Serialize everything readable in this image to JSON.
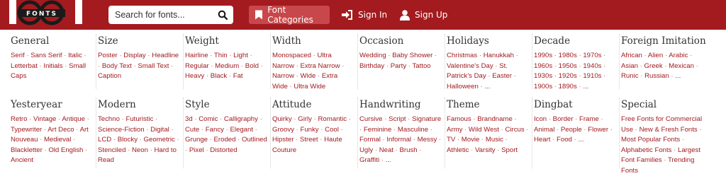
{
  "logo": {
    "text": "1001 FONTS",
    "small": "FONTS"
  },
  "search": {
    "placeholder": "Search for fonts..."
  },
  "nav": {
    "categories_label": "Font Categories",
    "signin_label": "Sign In",
    "signup_label": "Sign Up"
  },
  "categories": [
    {
      "title": "General",
      "links": [
        "Serif",
        "Sans Serif",
        "Italic",
        "Letterbat",
        "Initials",
        "Small Caps"
      ]
    },
    {
      "title": "Size",
      "links": [
        "Poster",
        "Display",
        "Headline",
        "Body Text",
        "Small Text",
        "Caption"
      ]
    },
    {
      "title": "Weight",
      "links": [
        "Hairline",
        "Thin",
        "Light",
        "Regular",
        "Medium",
        "Bold",
        "Heavy",
        "Black",
        "Fat"
      ]
    },
    {
      "title": "Width",
      "links": [
        "Monospaced",
        "Ultra Narrow",
        "Extra Narrow",
        "Narrow",
        "Wide",
        "Extra Wide",
        "Ultra Wide"
      ]
    },
    {
      "title": "Occasion",
      "links": [
        "Wedding",
        "Baby Shower",
        "Birthday",
        "Party",
        "Tattoo"
      ]
    },
    {
      "title": "Holidays",
      "links": [
        "Christmas",
        "Hanukkah",
        "Valentine's Day",
        "St. Patrick's Day",
        "Easter",
        "Halloween",
        "..."
      ]
    },
    {
      "title": "Decade",
      "links": [
        "1990s",
        "1980s",
        "1970s",
        "1960s",
        "1950s",
        "1940s",
        "1930s",
        "1920s",
        "1910s",
        "1900s",
        "1890s",
        "..."
      ]
    },
    {
      "title": "Foreign Imitation",
      "links": [
        "African",
        "Alien",
        "Arabic",
        "Asian",
        "Greek",
        "Mexican",
        "Runic",
        "Russian",
        "..."
      ]
    },
    {
      "title": "Yesteryear",
      "links": [
        "Retro",
        "Vintage",
        "Antique",
        "Typewriter",
        "Art Deco",
        "Art Nouveau",
        "Medieval",
        "Blackletter",
        "Old English",
        "Ancient"
      ]
    },
    {
      "title": "Modern",
      "links": [
        "Techno",
        "Futuristic",
        "Science-Fiction",
        "Digital",
        "LCD",
        "Blocky",
        "Geometric",
        "Stenciled",
        "Neon",
        "Hard to Read"
      ]
    },
    {
      "title": "Style",
      "links": [
        "3d",
        "Comic",
        "Calligraphy",
        "Cute",
        "Fancy",
        "Elegant",
        "Grunge",
        "Eroded",
        "Outlined",
        "Pixel",
        "Distorted"
      ]
    },
    {
      "title": "Attitude",
      "links": [
        "Quirky",
        "Girly",
        "Romantic",
        "Groovy",
        "Funky",
        "Cool",
        "Hipster",
        "Street",
        "Haute Couture"
      ]
    },
    {
      "title": "Handwriting",
      "links": [
        "Cursive",
        "Script",
        "Signature",
        "Feminine",
        "Masculine",
        "Formal",
        "Informal",
        "Messy",
        "Ugly",
        "Neat",
        "Brush",
        "Graffiti",
        "..."
      ]
    },
    {
      "title": "Theme",
      "links": [
        "Famous",
        "Brandname",
        "Army",
        "Wild West",
        "Circus",
        "TV",
        "Movie",
        "Music",
        "Athletic",
        "Varsity",
        "Sport"
      ]
    },
    {
      "title": "Dingbat",
      "links": [
        "Icon",
        "Border",
        "Frame",
        "Animal",
        "People",
        "Flower",
        "Heart",
        "Food",
        "..."
      ]
    },
    {
      "title": "Special",
      "links": [
        "Free Fonts for Commercial Use",
        "New & Fresh Fonts",
        "Most Popular Fonts",
        "Alphabetic Fonts",
        "Largest Font Families",
        "Trending Fonts"
      ]
    }
  ],
  "colors": {
    "brand": "#a31b1f",
    "brand_button": "#c8474b",
    "link": "#a31b1f",
    "heading": "#333333"
  },
  "icons": {
    "search": "search-icon",
    "categories": "bookmark-icon",
    "signin": "sign-in-icon",
    "signup": "user-icon"
  }
}
